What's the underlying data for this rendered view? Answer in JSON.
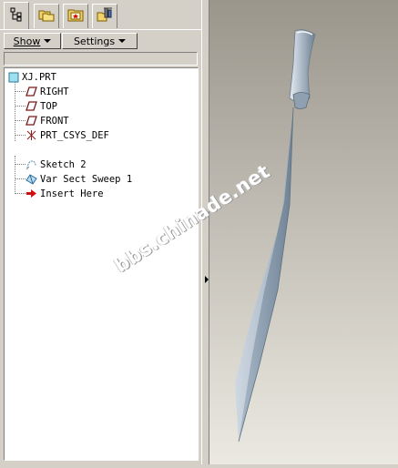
{
  "toolbar": {
    "tabs": [
      {
        "icon": "model-tree-icon"
      },
      {
        "icon": "folder-browser-icon"
      },
      {
        "icon": "favorites-icon"
      },
      {
        "icon": "connections-icon"
      }
    ],
    "show_label": "Show",
    "settings_label": "Settings"
  },
  "tree": {
    "root": "XJ.PRT",
    "items": [
      {
        "label": "RIGHT",
        "icon": "datum-plane-icon"
      },
      {
        "label": "TOP",
        "icon": "datum-plane-icon"
      },
      {
        "label": "FRONT",
        "icon": "datum-plane-icon"
      },
      {
        "label": "PRT_CSYS_DEF",
        "icon": "coordinate-system-icon"
      },
      {
        "label": "Sketch 2",
        "icon": "sketch-icon"
      },
      {
        "label": "Var Sect Sweep 1",
        "icon": "sweep-icon"
      },
      {
        "label": "Insert Here",
        "icon": "insert-arrow-icon"
      }
    ]
  },
  "viewport": {
    "watermark": "bbs.chinade.net",
    "background_top": "#9a968c",
    "background_bottom": "#ebe9e2"
  }
}
